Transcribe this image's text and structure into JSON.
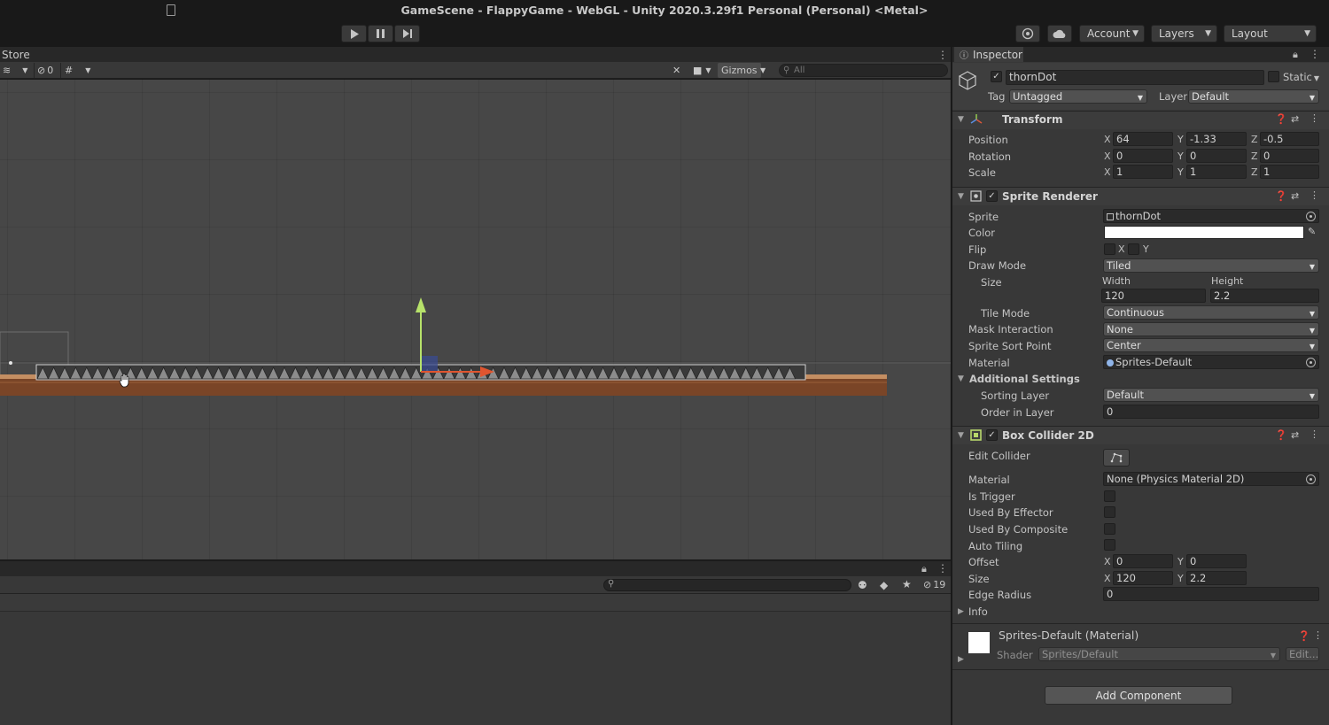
{
  "window": {
    "title": "GameScene - FlappyGame - WebGL - Unity 2020.3.29f1 Personal (Personal) <Metal>"
  },
  "toolbar": {
    "account_label": "Account",
    "layers_label": "Layers",
    "layout_label": "Layout"
  },
  "scene": {
    "tab_label": "Store",
    "hidden_count": "0",
    "gizmos_label": "Gizmos",
    "search_placeholder": "All"
  },
  "lower_panel": {
    "hidden_count": "19"
  },
  "inspector": {
    "tab_label": "Inspector",
    "object_name": "thornDot",
    "static_label": "Static",
    "tag_label": "Tag",
    "tag_value": "Untagged",
    "layer_label": "Layer",
    "layer_value": "Default",
    "transform": {
      "title": "Transform",
      "position_label": "Position",
      "rotation_label": "Rotation",
      "scale_label": "Scale",
      "axis_x": "X",
      "axis_y": "Y",
      "axis_z": "Z",
      "position": {
        "x": "64",
        "y": "-1.33",
        "z": "-0.5"
      },
      "rotation": {
        "x": "0",
        "y": "0",
        "z": "0"
      },
      "scale": {
        "x": "1",
        "y": "1",
        "z": "1"
      }
    },
    "sprite_renderer": {
      "title": "Sprite Renderer",
      "sprite_label": "Sprite",
      "sprite_value": "thornDot",
      "color_label": "Color",
      "color_value": "#ffffff",
      "flip_label": "Flip",
      "flip_x": "X",
      "flip_y": "Y",
      "draw_mode_label": "Draw Mode",
      "draw_mode_value": "Tiled",
      "size_label": "Size",
      "width_label": "Width",
      "height_label": "Height",
      "width_value": "120",
      "height_value": "2.2",
      "tile_mode_label": "Tile Mode",
      "tile_mode_value": "Continuous",
      "mask_interaction_label": "Mask Interaction",
      "mask_interaction_value": "None",
      "sort_point_label": "Sprite Sort Point",
      "sort_point_value": "Center",
      "material_label": "Material",
      "material_value": "Sprites-Default",
      "additional_settings_label": "Additional Settings",
      "sorting_layer_label": "Sorting Layer",
      "sorting_layer_value": "Default",
      "order_label": "Order in Layer",
      "order_value": "0"
    },
    "box_collider": {
      "title": "Box Collider 2D",
      "edit_collider_label": "Edit Collider",
      "material_label": "Material",
      "material_value": "None (Physics Material 2D)",
      "is_trigger_label": "Is Trigger",
      "used_by_effector_label": "Used By Effector",
      "used_by_composite_label": "Used By Composite",
      "auto_tiling_label": "Auto Tiling",
      "offset_label": "Offset",
      "offset_x": "0",
      "offset_y": "0",
      "size_label": "Size",
      "size_x": "120",
      "size_y": "2.2",
      "edge_radius_label": "Edge Radius",
      "edge_radius_value": "0",
      "info_label": "Info"
    },
    "material": {
      "title": "Sprites-Default (Material)",
      "shader_label": "Shader",
      "shader_value": "Sprites/Default",
      "edit_label": "Edit..."
    },
    "add_component_label": "Add Component"
  },
  "colors": {
    "accent_green": "#b7e26a",
    "accent_red": "#e0552f",
    "ground_brown": "#7a4527"
  }
}
